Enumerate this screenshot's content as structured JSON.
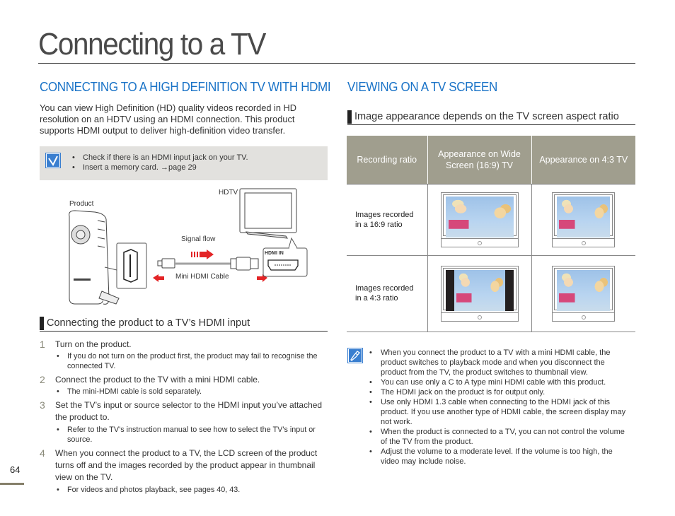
{
  "page": {
    "title": "Connecting to a TV",
    "page_number": "64"
  },
  "left": {
    "heading": "CONNECTING TO A HIGH DEFINITION TV WITH HDMI",
    "intro": "You can view High Definition (HD) quality videos recorded in HD resolution on an HDTV using an HDMI connection. This product supports HDMI output to deliver high-definition video transfer.",
    "prereq": {
      "icon": "checkbox-icon",
      "items": [
        "Check if there is an HDMI input jack on your TV.",
        "Insert a memory card. →page 29"
      ]
    },
    "diagram": {
      "product_label": "Product",
      "hdtv_label": "HDTV",
      "signal_label": "Signal flow",
      "cable_label": "Mini HDMI Cable",
      "port_label": "HDMI IN",
      "arrow_color": "#e32426"
    },
    "subheading": "Connecting the product to a TV’s HDMI input",
    "steps": [
      {
        "num": "1",
        "text": "Turn on the product.",
        "subs": [
          "If you do not turn on the product first, the product may fail to recognise the connected TV."
        ]
      },
      {
        "num": "2",
        "text": "Connect the product to the TV with a mini HDMI cable.",
        "subs": [
          "The mini-HDMI cable is sold separately."
        ]
      },
      {
        "num": "3",
        "text": "Set the TV’s input or source selector to the HDMI input you’ve attached the product to.",
        "subs": [
          "Refer to the TV’s instruction manual to see how to select the TV’s input or source."
        ]
      },
      {
        "num": "4",
        "text": "When you connect the product to a TV, the LCD screen of the product turns off and the images recorded by the product appear in thumbnail view on the TV.",
        "subs": [
          "For videos and photos playback, see pages 40, 43."
        ]
      }
    ]
  },
  "right": {
    "heading": "VIEWING ON A TV SCREEN",
    "subheading": "Image appearance depends on the TV screen aspect ratio",
    "table": {
      "headers": [
        "Recording ratio",
        "Appearance on Wide Screen (16:9) TV",
        "Appearance on 4:3 TV"
      ],
      "rows": [
        {
          "label": "Images recorded in a 16:9 ratio",
          "wide": "full-image",
          "standard": "full-image"
        },
        {
          "label": "Images recorded in a 4:3 ratio",
          "wide": "pillarboxed-image",
          "standard": "full-image"
        }
      ]
    },
    "notes": {
      "icon": "note-pencil-icon",
      "items": [
        "When you connect the product to a TV with a mini HDMI cable, the product switches to playback mode and when you disconnect the product from the TV, the product switches to thumbnail view.",
        "You can use only a C to A type mini HDMI cable with this product.",
        "The HDMI jack on the product is for output only.",
        "Use only HDMI 1.3 cable when connecting to the HDMI jack of this product. If you use another type of HDMI cable, the screen display may not work.",
        "When the product is connected to a TV, you can not control the volume of the TV from the product.",
        "Adjust the volume to a moderate level. If the volume is too high, the video may include noise."
      ]
    }
  },
  "colors": {
    "heading_blue": "#1a73c7",
    "table_header": "#a09e8e",
    "prereq_bg": "#e2e1de",
    "icon_blue": "#3a7fd0"
  }
}
